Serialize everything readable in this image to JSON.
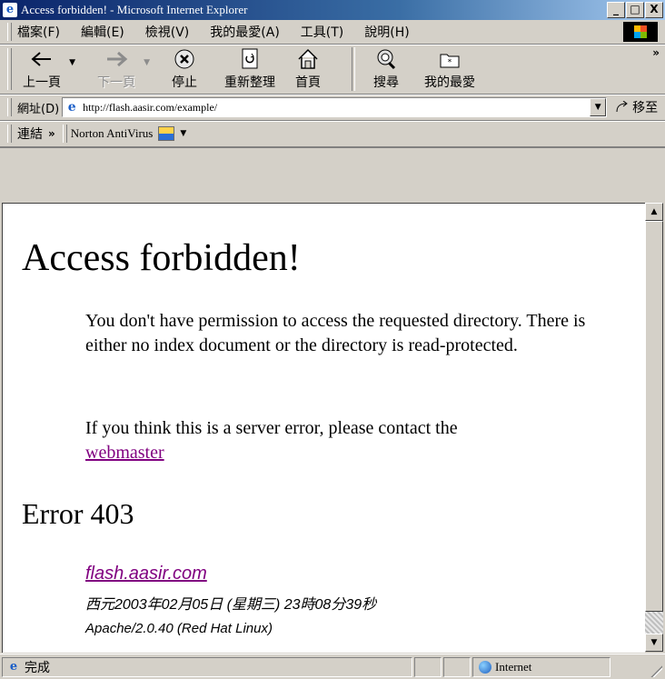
{
  "window": {
    "title": "Access forbidden! - Microsoft Internet Explorer",
    "buttons": [
      "_",
      "□",
      "X"
    ]
  },
  "menu": [
    "檔案(F)",
    "編輯(E)",
    "檢視(V)",
    "我的最愛(A)",
    "工具(T)",
    "說明(H)"
  ],
  "toolbar": {
    "back": "上一頁",
    "forward": "下一頁",
    "stop": "停止",
    "refresh": "重新整理",
    "home": "首頁",
    "search": "搜尋",
    "favorites": "我的最愛",
    "overflow": "»"
  },
  "address": {
    "label": "網址(D)",
    "url": "http://flash.aasir.com/example/",
    "go": "移至"
  },
  "links": {
    "label": "連結",
    "chevron": "»",
    "norton": "Norton AntiVirus"
  },
  "page": {
    "heading": "Access forbidden!",
    "para1": "You don't have permission to access the requested directory. There is either no index document or the directory is read-protected.",
    "para2_text": "If you think this is a server error, please contact the",
    "para2_link": "webmaster",
    "error_title": "Error 403",
    "host_link": "flash.aasir.com",
    "date": "西元2003年02月05日 (星期三) 23時08分39秒",
    "server": "Apache/2.0.40 (Red Hat Linux)"
  },
  "status": {
    "text": "完成",
    "zone": "Internet"
  }
}
